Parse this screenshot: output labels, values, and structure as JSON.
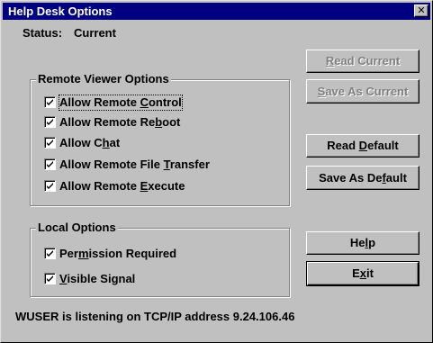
{
  "window": {
    "title": "Help Desk Options",
    "close_glyph": "✕"
  },
  "status": {
    "label": "Status:",
    "value": "Current"
  },
  "remote_group": {
    "title": "Remote Viewer Options",
    "items": [
      {
        "pre": "Allow Remote ",
        "key": "C",
        "post": "ontrol",
        "checked": true
      },
      {
        "pre": "Allow Remote Re",
        "key": "b",
        "post": "oot",
        "checked": true
      },
      {
        "pre": "Allow C",
        "key": "h",
        "post": "at",
        "checked": true
      },
      {
        "pre": "Allow Remote File ",
        "key": "T",
        "post": "ransfer",
        "checked": true
      },
      {
        "pre": "Allow Remote ",
        "key": "E",
        "post": "xecute",
        "checked": true
      }
    ]
  },
  "local_group": {
    "title": "Local Options",
    "items": [
      {
        "pre": "Per",
        "key": "m",
        "post": "ission Required",
        "checked": true
      },
      {
        "pre": "",
        "key": "V",
        "post": "isible Signal",
        "checked": true
      }
    ]
  },
  "buttons": {
    "read_current": {
      "pre": "",
      "key": "R",
      "post": "ead Current",
      "enabled": false
    },
    "save_as_current": {
      "pre": "",
      "key": "S",
      "post": "ave As Current",
      "enabled": false
    },
    "read_default": {
      "pre": "Read ",
      "key": "D",
      "post": "efault",
      "enabled": true
    },
    "save_as_default": {
      "pre": "Save As De",
      "key": "f",
      "post": "ault",
      "enabled": true
    },
    "help": {
      "pre": "He",
      "key": "l",
      "post": "p",
      "enabled": true
    },
    "exit": {
      "pre": "E",
      "key": "x",
      "post": "it",
      "enabled": true
    }
  },
  "footer": {
    "message": "WUSER is listening on TCP/IP address 9.24.106.46"
  },
  "colors": {
    "title_bar": "#000080",
    "face": "#c0c0c0",
    "disabled_text": "#808080"
  },
  "icons": {
    "check": "check-mark-icon",
    "close": "close-icon"
  }
}
